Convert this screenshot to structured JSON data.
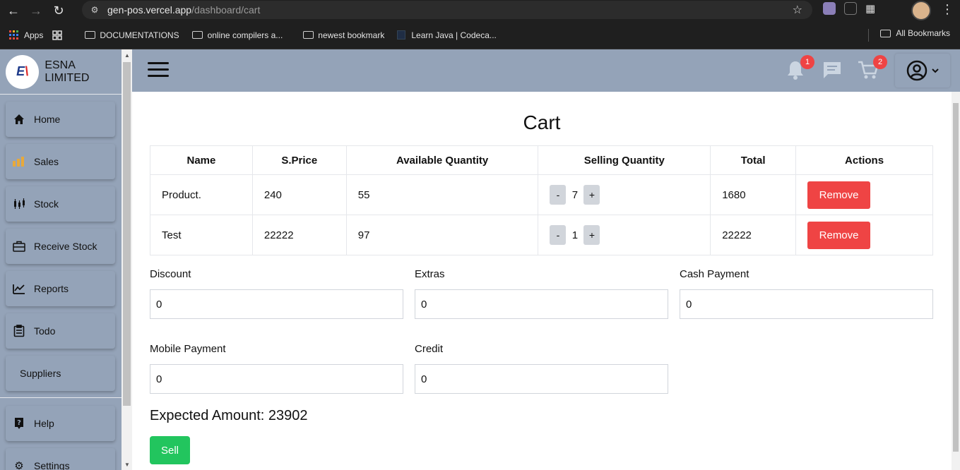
{
  "browser": {
    "url_host": "gen-pos.vercel.app",
    "url_path": "/dashboard/cart",
    "bookmarks": [
      "Apps",
      "DOCUMENTATIONS",
      "online compilers a...",
      "newest bookmark",
      "Learn Java | Codeca..."
    ],
    "all_bookmarks": "All Bookmarks"
  },
  "sidebar": {
    "brand": "ESNA LIMITED",
    "items": [
      {
        "label": "Home",
        "icon": "home-icon"
      },
      {
        "label": "Sales",
        "icon": "sales-icon"
      },
      {
        "label": "Stock",
        "icon": "stock-icon"
      },
      {
        "label": "Receive Stock",
        "icon": "receive-stock-icon"
      },
      {
        "label": "Reports",
        "icon": "reports-icon"
      },
      {
        "label": "Todo",
        "icon": "todo-icon"
      },
      {
        "label": "Suppliers",
        "icon": ""
      },
      {
        "label": "Help",
        "icon": "help-icon"
      },
      {
        "label": "Settings",
        "icon": "settings-icon"
      }
    ]
  },
  "header": {
    "notification_count": "1",
    "cart_count": "2"
  },
  "cart": {
    "title": "Cart",
    "columns": [
      "Name",
      "S.Price",
      "Available Quantity",
      "Selling Quantity",
      "Total",
      "Actions"
    ],
    "rows": [
      {
        "name": "Product.",
        "price": "240",
        "available": "55",
        "qty": "7",
        "total": "1680"
      },
      {
        "name": "Test",
        "price": "22222",
        "available": "97",
        "qty": "1",
        "total": "22222"
      }
    ],
    "minus": "-",
    "plus": "+",
    "remove_label": "Remove"
  },
  "payment": {
    "discount_label": "Discount",
    "discount_value": "0",
    "extras_label": "Extras",
    "extras_value": "0",
    "cash_label": "Cash Payment",
    "cash_value": "0",
    "mobile_label": "Mobile Payment",
    "mobile_value": "0",
    "credit_label": "Credit",
    "credit_value": "0"
  },
  "summary": {
    "expected_amount": "Expected Amount: 23902",
    "sell_label": "Sell"
  },
  "colors": {
    "sidebar": "#94a3b8",
    "danger": "#ef4444",
    "success": "#22c55e"
  }
}
